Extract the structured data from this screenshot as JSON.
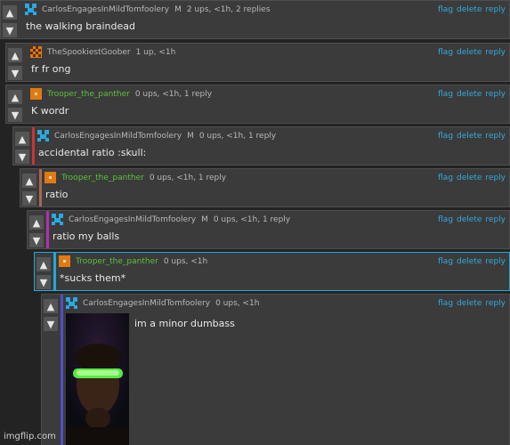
{
  "actions": {
    "flag": "flag",
    "delete": "delete",
    "reply": "reply"
  },
  "vote_icons": {
    "up": "arrow-up-icon",
    "down": "arrow-down-icon"
  },
  "comments": [
    {
      "user": "CarlosEngagesInMildTomfoolery",
      "mod": "M",
      "meta": "2 ups, <1h, 2 replies",
      "text": "the walking braindead",
      "border_color": "#3b3b3b",
      "avatar": "blue-pixel-avatar"
    },
    {
      "user": "TheSpookiestGoober",
      "mod": "",
      "meta": "1 up, <1h",
      "text": "fr fr ong",
      "border_color": "#3b3b3b",
      "avatar": "orange-checker-avatar"
    },
    {
      "user": "Trooper_the_panther",
      "mod": "",
      "meta": "0 ups, <1h, 1 reply",
      "text": "K wordr",
      "border_color": "#3b3b3b",
      "avatar": "orange-square-avatar"
    },
    {
      "user": "CarlosEngagesInMildTomfoolery",
      "mod": "M",
      "meta": "0 ups, <1h, 1 reply",
      "text": "accidental ratio :skull:",
      "border_color": "#cc3333",
      "avatar": "blue-pixel-avatar"
    },
    {
      "user": "Trooper_the_panther",
      "mod": "",
      "meta": "0 ups, <1h, 1 reply",
      "text": "ratio",
      "border_color": "#aa6655",
      "avatar": "orange-square-avatar"
    },
    {
      "user": "CarlosEngagesInMildTomfoolery",
      "mod": "M",
      "meta": "0 ups, <1h, 1 reply",
      "text": "ratio my balls",
      "border_color": "#b030b0",
      "avatar": "blue-pixel-avatar"
    },
    {
      "user": "Trooper_the_panther",
      "mod": "",
      "meta": "0 ups, <1h",
      "text": "*sucks them*",
      "border_color": "#22a8d8",
      "avatar": "orange-square-avatar"
    },
    {
      "user": "CarlosEngagesInMildTomfoolery",
      "mod": "",
      "meta": "0 ups, <1h",
      "text": "im a minor dumbass",
      "border_color": "#5050c8",
      "avatar": "blue-pixel-avatar"
    }
  ],
  "watermark": "imgflip.com"
}
